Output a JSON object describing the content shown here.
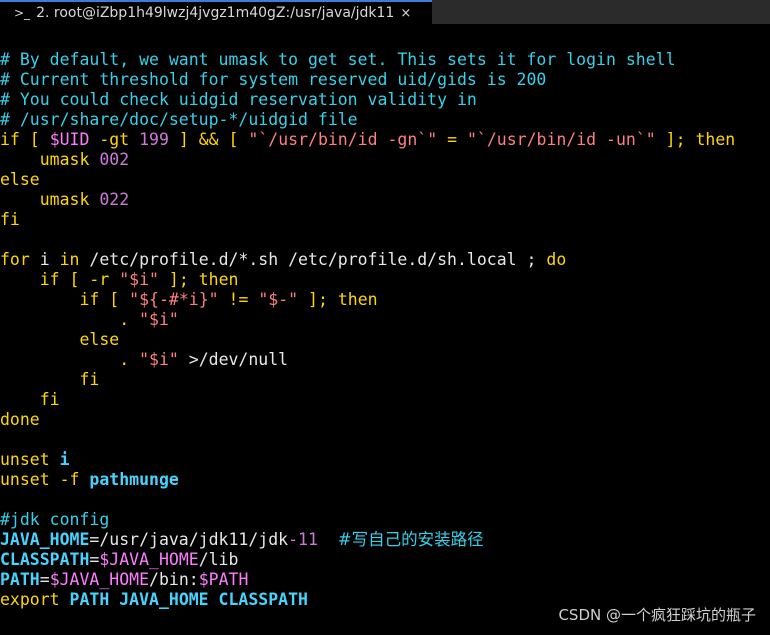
{
  "window": {
    "tab_icon": ">_",
    "tab_title": "2. root@iZbp1h49lwzj4jvgz1m40gZ:/usr/java/jdk11",
    "tab_close": "×"
  },
  "code": {
    "l1": "# By default, we want umask to get set. This sets it for login shell",
    "l2": "# Current threshold for system reserved uid/gids is 200",
    "l3": "# You could check uidgid reservation validity in",
    "l4": "# /usr/share/doc/setup-*/uidgid file",
    "l5_if": "if",
    "l5_br1": " [ ",
    "l5_uid": "$UID",
    "l5_gt": " -gt ",
    "l5_199": "199",
    "l5_br2": " ] && [ ",
    "l5_str1": "\"`/usr/bin/id -gn`\"",
    "l5_eq": " = ",
    "l5_str2": "\"`/usr/bin/id -un`\"",
    "l5_br3": " ]; ",
    "l5_then": "then",
    "l6_cmd": "    umask ",
    "l6_num": "002",
    "l7": "else",
    "l8_cmd": "    umask ",
    "l8_num": "022",
    "l9": "fi",
    "l11_for": "for",
    "l11_mid": " i ",
    "l11_in": "in",
    "l11_paths": " /etc/profile.d/*.sh /etc/profile.d/sh.local ; ",
    "l11_do": "do",
    "l12_ind": "    ",
    "l12_if": "if",
    "l12_mid": " [ -r ",
    "l12_str": "\"$i\"",
    "l12_end": " ]; ",
    "l12_then": "then",
    "l13_ind": "        ",
    "l13_if": "if",
    "l13_mid": " [ ",
    "l13_str1": "\"${-#*i}\"",
    "l13_ne": " != ",
    "l13_str2": "\"$-\"",
    "l13_end": " ]; ",
    "l13_then": "then",
    "l14_ind": "            . ",
    "l14_str": "\"$i\"",
    "l15_ind": "        ",
    "l15_else": "else",
    "l16_ind": "            . ",
    "l16_str": "\"$i\"",
    "l16_end": " >/dev/null",
    "l17_ind": "        ",
    "l17_fi": "fi",
    "l18_ind": "    ",
    "l18_fi": "fi",
    "l19": "done",
    "l21_cmd": "unset ",
    "l21_arg": "i",
    "l22_cmd": "unset -f ",
    "l22_arg": "pathmunge",
    "l24": "#jdk config",
    "l25_var": "JAVA_HOME",
    "l25_val": "=/usr/java/jdk11/jdk",
    "l25_num": "-11",
    "l25_sp": "  ",
    "l25_comment": "#写自己的安装路径",
    "l26_var": "CLASSPATH",
    "l26_eq": "=",
    "l26_ref": "$JAVA_HOME",
    "l26_tail": "/lib",
    "l27_var": "PATH",
    "l27_eq": "=",
    "l27_ref1": "$JAVA_HOME",
    "l27_mid": "/bin:",
    "l27_ref2": "$PATH",
    "l28_cmd": "export ",
    "l28_vars": "PATH JAVA_HOME CLASSPATH"
  },
  "watermark": "CSDN @一个疯狂踩坑的瓶子"
}
